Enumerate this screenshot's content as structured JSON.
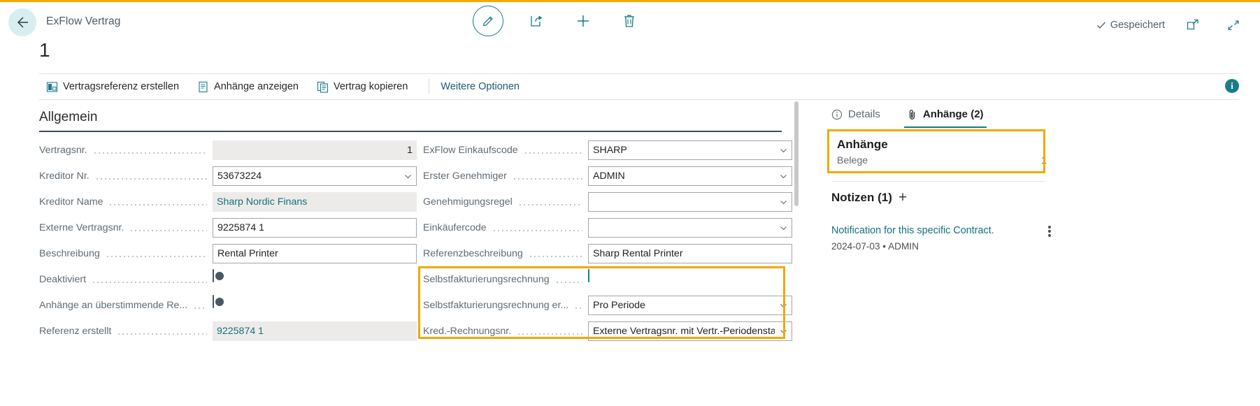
{
  "theme": {
    "accent_teal": "#0f7c87",
    "highlight_orange": "#f2a900",
    "link_teal": "#14707d",
    "label_gray": "#5f6b74"
  },
  "header": {
    "back_label": "Zurück",
    "breadcrumb": "ExFlow Vertrag",
    "record_no": "1",
    "saved_label": "Gespeichert",
    "actions": [
      {
        "name": "edit-icon",
        "label": "Bearbeiten"
      },
      {
        "name": "share-icon",
        "label": "Freigeben"
      },
      {
        "name": "plus-icon",
        "label": "Neu"
      },
      {
        "name": "trash-icon",
        "label": "Löschen"
      }
    ],
    "window_actions": [
      {
        "name": "open-new-window-icon",
        "label": "In neuem Fenster öffnen"
      },
      {
        "name": "collapse-icon",
        "label": "Reduzieren"
      }
    ]
  },
  "commandbar": {
    "items": [
      {
        "label": "Vertragsreferenz erstellen",
        "icon": "contract-reference-icon"
      },
      {
        "label": "Anhänge anzeigen",
        "icon": "attachment-page-icon"
      },
      {
        "label": "Vertrag kopieren",
        "icon": "copy-contract-icon"
      }
    ],
    "more_label": "Weitere Optionen",
    "info_label": "i"
  },
  "form": {
    "section_title": "Allgemein",
    "left_fields": [
      {
        "label": "Vertragsnr.",
        "value": "1",
        "type": "readonly-number"
      },
      {
        "label": "Kreditor Nr.",
        "value": "53673224",
        "type": "dropdown"
      },
      {
        "label": "Kreditor Name",
        "value": "Sharp Nordic Finans",
        "type": "readonly-link"
      },
      {
        "label": "Externe Vertragsnr.",
        "value": "9225874 1",
        "type": "text"
      },
      {
        "label": "Beschreibung",
        "value": "Rental Printer",
        "type": "text"
      },
      {
        "label": "Deaktiviert",
        "value": "",
        "type": "toggle",
        "on": false
      },
      {
        "label": "Anhänge an überstimmende Re...",
        "value": "",
        "type": "toggle",
        "on": false
      },
      {
        "label": "Referenz erstellt",
        "value": "9225874 1",
        "type": "readonly-link"
      }
    ],
    "right_fields": [
      {
        "label": "ExFlow Einkaufscode",
        "value": "SHARP",
        "type": "dropdown"
      },
      {
        "label": "Erster Genehmiger",
        "value": "ADMIN",
        "type": "dropdown"
      },
      {
        "label": "Genehmigungsregel",
        "value": "",
        "type": "dropdown"
      },
      {
        "label": "Einkäufercode",
        "value": "",
        "type": "dropdown"
      },
      {
        "label": "Referenzbeschreibung",
        "value": "Sharp Rental Printer",
        "type": "text"
      },
      {
        "label": "Selbstfakturierungsrechnung",
        "value": "",
        "type": "toggle",
        "on": true
      },
      {
        "label": "Selbstfakturierungsrechnung er...",
        "value": "Pro Periode",
        "type": "dropdown"
      },
      {
        "label": "Kred.-Rechnungsnr.",
        "value": "Externe Vertragsnr. mit Vertr.-Periodenstartda",
        "type": "dropdown"
      }
    ]
  },
  "factbox": {
    "tabs": [
      {
        "label": "Details",
        "icon": "info-circle-icon",
        "active": false
      },
      {
        "label": "Anhänge (2)",
        "icon": "paperclip-icon",
        "active": true
      }
    ],
    "attachments_card": {
      "title": "Anhänge",
      "rows": [
        {
          "label": "Belege",
          "value": "1"
        }
      ]
    },
    "notes": {
      "title": "Notizen (1)",
      "add_label": "+",
      "items": [
        {
          "text": "Notification for this specific Contract.",
          "meta": "2024-07-03 • ADMIN",
          "menu_label": "⋮"
        }
      ]
    }
  }
}
